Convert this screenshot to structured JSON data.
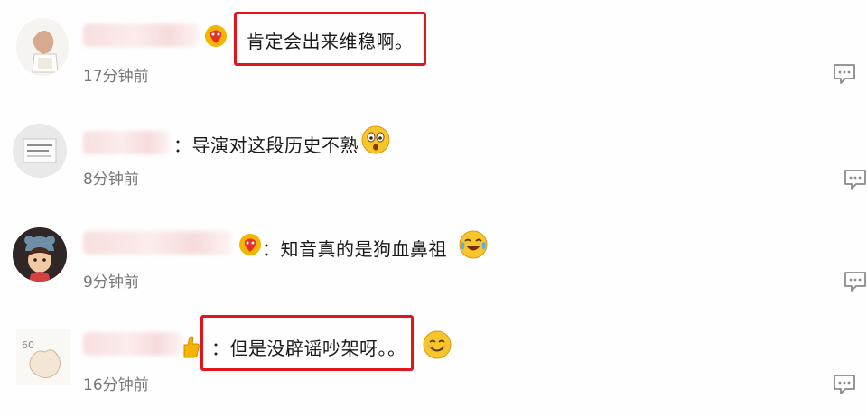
{
  "comments": [
    {
      "text": "肯定会出来维稳啊。",
      "time": "17分钟前"
    },
    {
      "text": "：导演对这段历史不熟",
      "time": "8分钟前",
      "emoji": "surprised-emoji-icon"
    },
    {
      "text": "：知音真的是狗血鼻祖",
      "time": "9分钟前",
      "emoji": "laughing-crying-emoji-icon"
    },
    {
      "text": "：但是没辟谣吵架呀。。",
      "time": "16分钟前",
      "emoji": "smiling-emoji-icon"
    }
  ],
  "colors": {
    "highlight": "#e2141d",
    "time": "#777777",
    "text": "#1a1a1a"
  }
}
